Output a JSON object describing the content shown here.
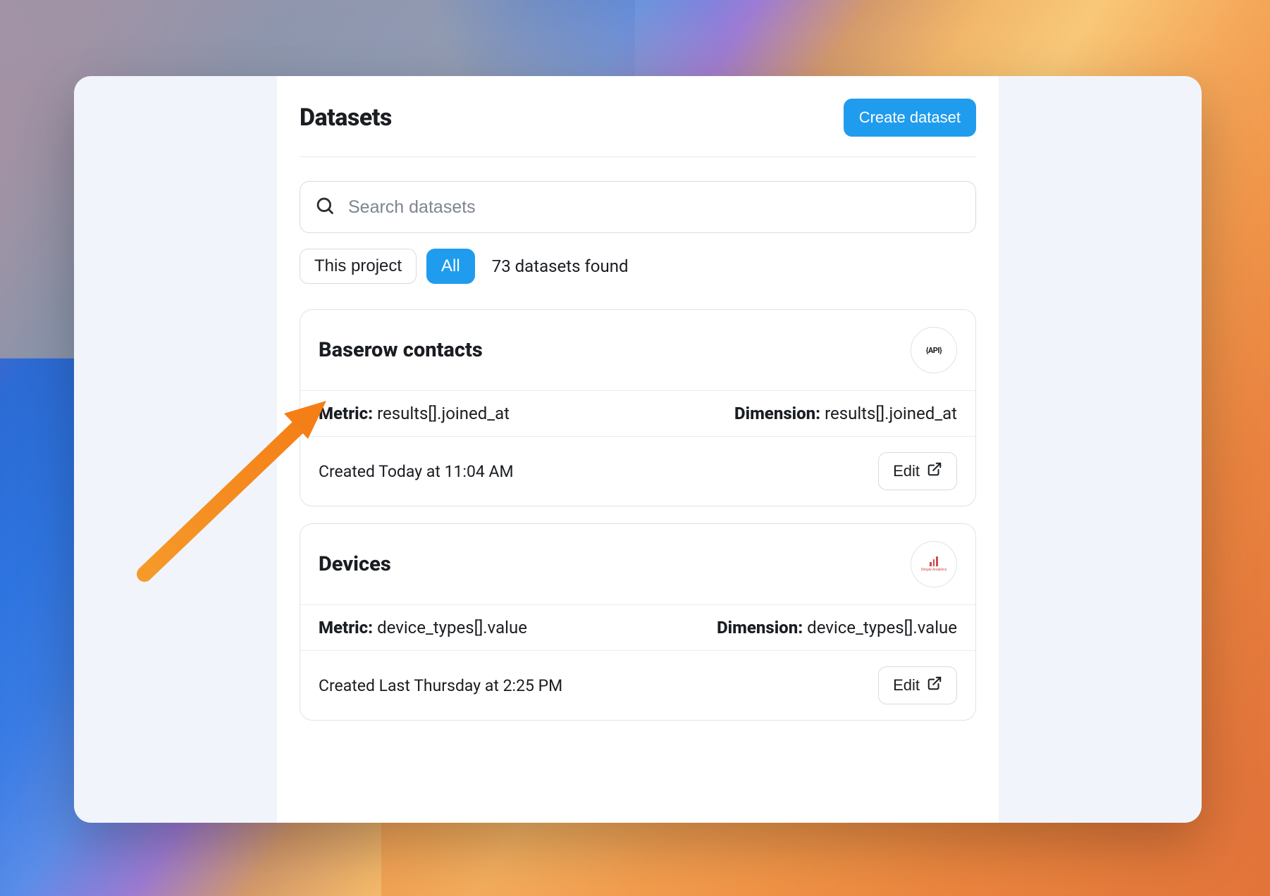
{
  "header": {
    "title": "Datasets",
    "create_label": "Create dataset"
  },
  "search": {
    "placeholder": "Search datasets"
  },
  "filters": {
    "this_project_label": "This project",
    "all_label": "All",
    "found_text": "73 datasets found"
  },
  "cards": [
    {
      "title": "Baserow contacts",
      "badge_type": "api",
      "badge_text": "{API}",
      "metric_label": "Metric:",
      "metric_value": "results[].joined_at",
      "dimension_label": "Dimension:",
      "dimension_value": "results[].joined_at",
      "created_text": "Created Today at 11:04 AM",
      "edit_label": "Edit"
    },
    {
      "title": "Devices",
      "badge_type": "analytics",
      "badge_text": "Simple Analytics",
      "metric_label": "Metric:",
      "metric_value": "device_types[].value",
      "dimension_label": "Dimension:",
      "dimension_value": "device_types[].value",
      "created_text": "Created Last Thursday at 2:25 PM",
      "edit_label": "Edit"
    }
  ]
}
